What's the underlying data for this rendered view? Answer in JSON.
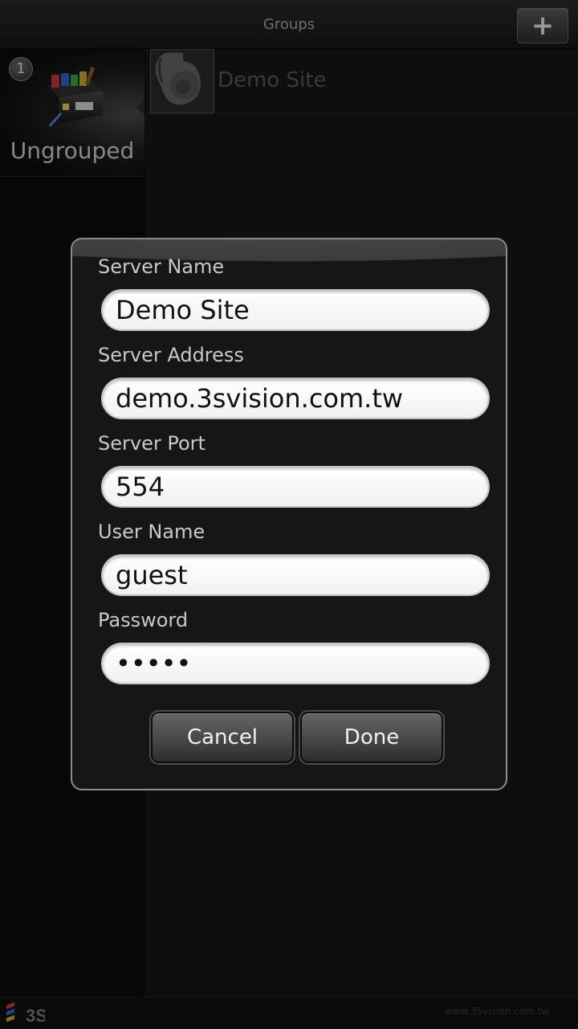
{
  "header": {
    "title": "Groups",
    "add_label": "+"
  },
  "groups": [
    {
      "label": "Ungrouped",
      "count": "1"
    }
  ],
  "sites": [
    {
      "name": "Demo Site"
    }
  ],
  "dialog": {
    "fields": {
      "server_name": {
        "label": "Server Name",
        "value": "Demo Site"
      },
      "server_address": {
        "label": "Server Address",
        "value": "demo.3svision.com.tw"
      },
      "server_port": {
        "label": "Server Port",
        "value": "554"
      },
      "user_name": {
        "label": "User Name",
        "value": "guest"
      },
      "password": {
        "label": "Password",
        "value": "guest"
      }
    },
    "cancel_label": "Cancel",
    "done_label": "Done"
  },
  "footer": {
    "brand": "3S",
    "url": "www.3Svision.com.tw"
  },
  "icons": {
    "add": "plus-icon",
    "group": "toolbox-icon",
    "site": "ptz-camera-icon",
    "brand": "3s-logo"
  },
  "colors": {
    "background": "#0d0d0d",
    "dialog_border": "#8d8d8d",
    "button_top": "#656565",
    "button_bottom": "#2d2d2d"
  }
}
